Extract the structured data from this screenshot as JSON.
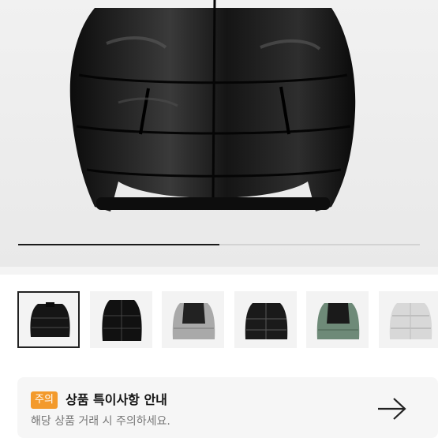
{
  "gallery": {
    "main_image": "black-down-puffer-jacket",
    "progress": 0.5
  },
  "thumbnails": [
    {
      "name": "black-matte-puffer",
      "selected": true
    },
    {
      "name": "black-glossy-puffer",
      "selected": false
    },
    {
      "name": "grey-black-puffer",
      "selected": false
    },
    {
      "name": "black-puffer",
      "selected": false
    },
    {
      "name": "green-black-puffer",
      "selected": false
    },
    {
      "name": "silver-puffer",
      "selected": false
    }
  ],
  "notice": {
    "badge": "주의",
    "title": "상품 특이사항 안내",
    "subtitle": "해당 상품 거래 시 주의하세요.",
    "arrow_icon": "arrow-right-icon"
  },
  "colors": {
    "badge_bg": "#f39a2c",
    "notice_bg": "#f6f6f6"
  }
}
